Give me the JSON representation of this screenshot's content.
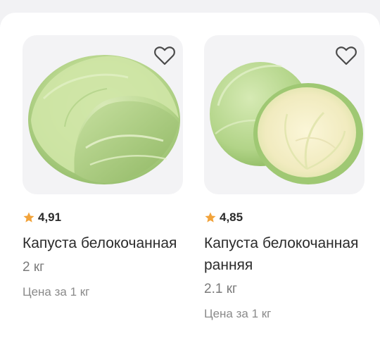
{
  "products": [
    {
      "rating": "4,91",
      "title": "Капуста белокочанная",
      "weight": "2 кг",
      "price_note": "Цена за 1 кг",
      "image": "whole-cabbage"
    },
    {
      "rating": "4,85",
      "title": "Капуста белокочанная ранняя",
      "weight": "2.1 кг",
      "price_note": "Цена за 1 кг",
      "image": "cabbage-half-cut"
    }
  ],
  "icons": {
    "favorite": "heart-outline-icon",
    "rating": "star-icon"
  },
  "colors": {
    "star": "#f2a33a",
    "text": "#2b2b2b",
    "muted": "#7a7a7a",
    "image_bg": "#f3f3f5"
  }
}
